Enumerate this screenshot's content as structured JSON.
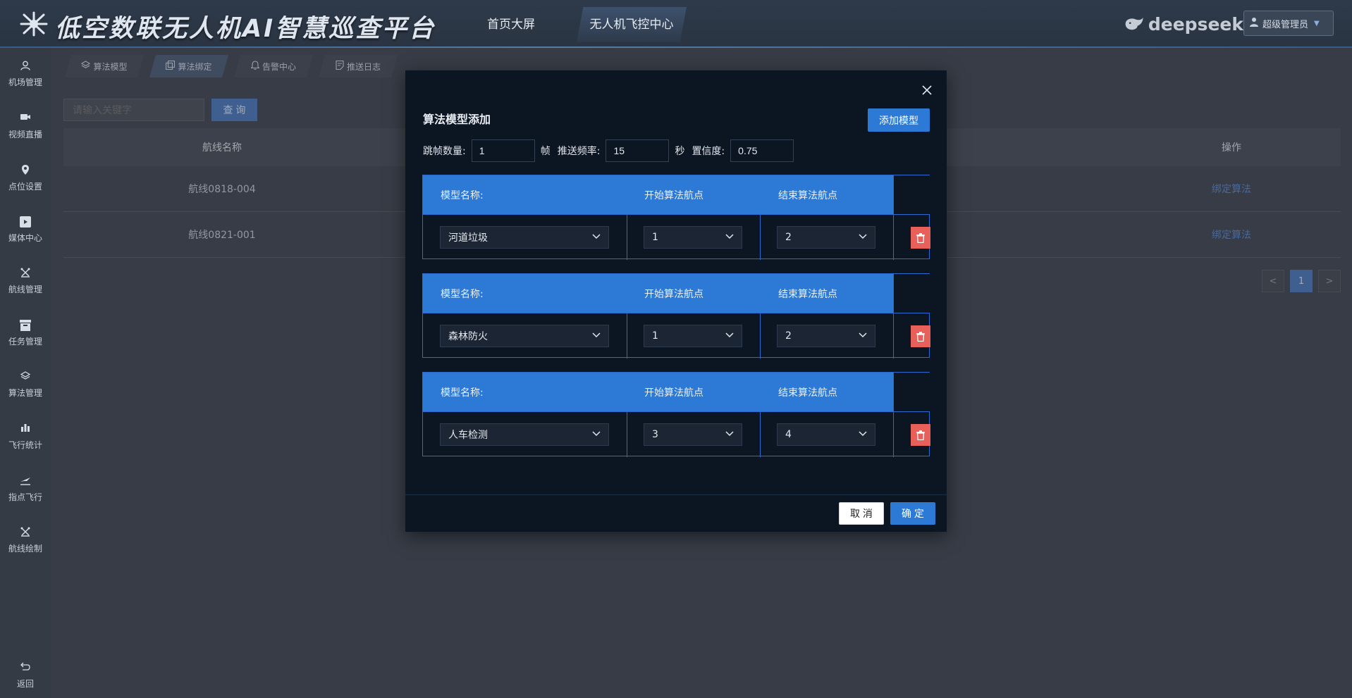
{
  "header": {
    "title": "低空数联无人机AI智慧巡查平台",
    "nav": [
      "首页大屏",
      "无人机飞控中心"
    ],
    "brand": "deepseek",
    "user": "超级管理员"
  },
  "sidebar": {
    "items": [
      {
        "label": "机场管理",
        "icon": "user-icon"
      },
      {
        "label": "视频直播",
        "icon": "video-icon"
      },
      {
        "label": "点位设置",
        "icon": "pin-icon"
      },
      {
        "label": "媒体中心",
        "icon": "media-icon"
      },
      {
        "label": "航线管理",
        "icon": "drone-icon"
      },
      {
        "label": "任务管理",
        "icon": "box-icon"
      },
      {
        "label": "算法管理",
        "icon": "layers-icon"
      },
      {
        "label": "飞行统计",
        "icon": "bar-chart-icon"
      },
      {
        "label": "指点飞行",
        "icon": "flight-icon"
      },
      {
        "label": "航线绘制",
        "icon": "drone-draw-icon"
      }
    ],
    "back": "返回"
  },
  "tabs": [
    "算法模型",
    "算法绑定",
    "告警中心",
    "推送日志"
  ],
  "search": {
    "placeholder": "请输入关键字",
    "button": "查 询"
  },
  "table": {
    "headers": {
      "name": "航线名称",
      "action": "操作"
    },
    "rows": [
      {
        "name": "航线0818-004",
        "action": "绑定算法"
      },
      {
        "name": "航线0821-001",
        "action": "绑定算法"
      }
    ]
  },
  "pagination": {
    "prev": "<",
    "current": "1",
    "next": ">"
  },
  "modal": {
    "title": "算法模型添加",
    "add_button": "添加模型",
    "params": {
      "skip_label": "跳帧数量:",
      "skip_value": "1",
      "skip_unit": "帧",
      "freq_label": "推送频率:",
      "freq_value": "15",
      "freq_unit": "秒",
      "conf_label": "置信度:",
      "conf_value": "0.75"
    },
    "col_labels": {
      "model": "模型名称:",
      "start": "开始算法航点",
      "end": "结束算法航点"
    },
    "models": [
      {
        "model": "河道垃圾",
        "start": "1",
        "end": "2"
      },
      {
        "model": "森林防火",
        "start": "1",
        "end": "2"
      },
      {
        "model": "人车检测",
        "start": "3",
        "end": "4"
      }
    ],
    "cancel": "取 消",
    "ok": "确 定"
  },
  "colors": {
    "accent": "#2d7ad6",
    "danger": "#e8605a",
    "modal_bg": "#0c1522"
  }
}
